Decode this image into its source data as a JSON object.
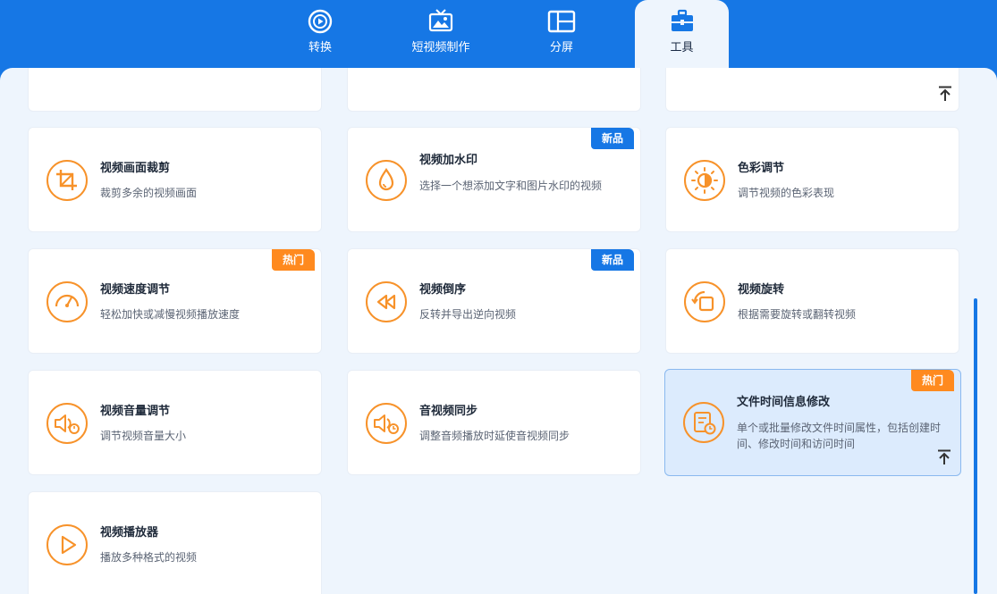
{
  "tabs": [
    {
      "label": "转换",
      "icon": "convert-icon"
    },
    {
      "label": "短视频制作",
      "icon": "short-video-icon"
    },
    {
      "label": "分屏",
      "icon": "split-screen-icon"
    },
    {
      "label": "工具",
      "icon": "toolbox-icon",
      "active": true
    }
  ],
  "cards": [
    {
      "title": "视频画面裁剪",
      "desc": "裁剪多余的视频画面",
      "icon": "crop-icon"
    },
    {
      "title": "视频加水印",
      "desc": "选择一个想添加文字和图片水印的视频",
      "icon": "watermark-drop-icon",
      "badge": "新品"
    },
    {
      "title": "色彩调节",
      "desc": "调节视频的色彩表现",
      "icon": "color-adjust-icon"
    },
    {
      "title": "视频速度调节",
      "desc": "轻松加快或减慢视频播放速度",
      "icon": "speedometer-icon",
      "badge": "热门"
    },
    {
      "title": "视频倒序",
      "desc": "反转并导出逆向视频",
      "icon": "rewind-icon",
      "badge": "新品"
    },
    {
      "title": "视频旋转",
      "desc": "根据需要旋转或翻转视频",
      "icon": "rotate-icon"
    },
    {
      "title": "视频音量调节",
      "desc": "调节视频音量大小",
      "icon": "volume-adjust-icon"
    },
    {
      "title": "音视频同步",
      "desc": "调整音频播放时延使音视频同步",
      "icon": "av-sync-icon"
    },
    {
      "title": "文件时间信息修改",
      "desc": "单个或批量修改文件时间属性，包括创建时间、修改时间和访问时间",
      "icon": "file-time-icon",
      "badge": "热门"
    },
    {
      "title": "视频播放器",
      "desc": "播放多种格式的视频",
      "icon": "play-icon"
    }
  ],
  "colors": {
    "brand_blue": "#1677e5",
    "accent_orange": "#f7922a",
    "hot_badge": "#ff8a1f",
    "background": "#eef5fd"
  }
}
